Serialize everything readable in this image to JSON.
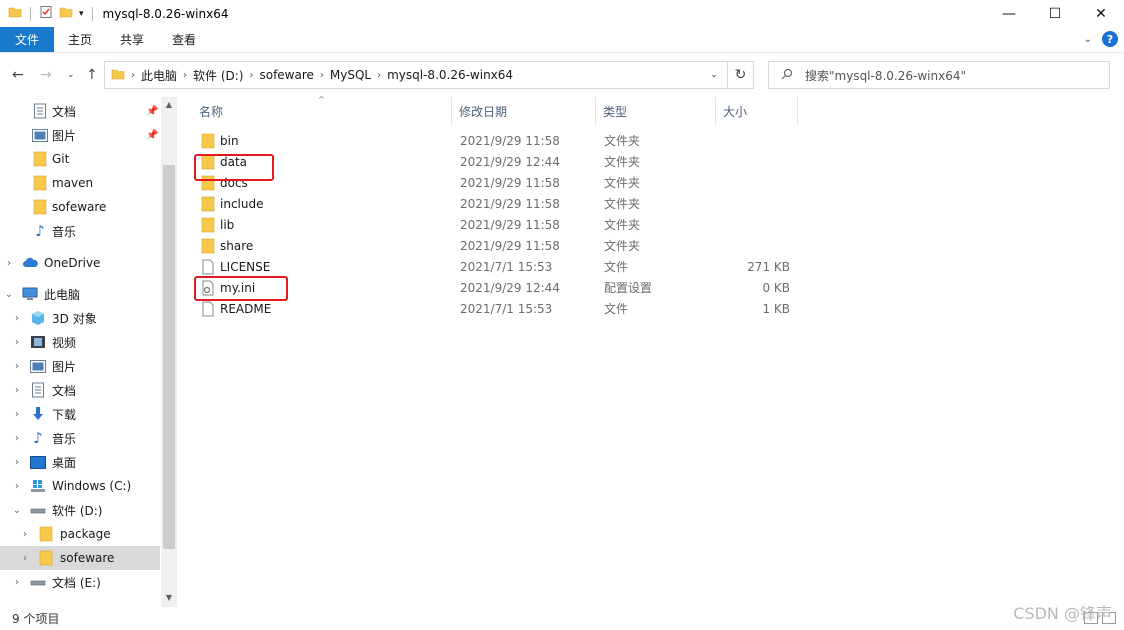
{
  "window": {
    "title": "mysql-8.0.26-winx64",
    "controls": [
      "minimize-icon",
      "maximize-icon",
      "close-icon"
    ]
  },
  "ribbon": {
    "tabs": [
      {
        "label": "文件",
        "active": true
      },
      {
        "label": "主页"
      },
      {
        "label": "共享"
      },
      {
        "label": "查看"
      }
    ],
    "accent_color": "#1979ca"
  },
  "address": {
    "crumbs": [
      "此电脑",
      "软件 (D:)",
      "sofeware",
      "MySQL",
      "mysql-8.0.26-winx64"
    ]
  },
  "search": {
    "placeholder": "搜索\"mysql-8.0.26-winx64\""
  },
  "sidebar": {
    "items": [
      {
        "label": "文档",
        "icon": "document-icon",
        "pinned": true
      },
      {
        "label": "图片",
        "icon": "picture-icon",
        "pinned": true
      },
      {
        "label": "Git",
        "icon": "folder-icon"
      },
      {
        "label": "maven",
        "icon": "folder-icon"
      },
      {
        "label": "sofeware",
        "icon": "folder-icon"
      },
      {
        "label": "音乐",
        "icon": "music-icon"
      },
      {
        "label": "OneDrive",
        "icon": "cloud-icon",
        "expander": "collapsed"
      },
      {
        "label": "此电脑",
        "icon": "computer-icon",
        "expander": "expanded"
      },
      {
        "label": "3D 对象",
        "icon": "cube-icon",
        "expander": "collapsed"
      },
      {
        "label": "视频",
        "icon": "video-icon",
        "expander": "collapsed"
      },
      {
        "label": "图片",
        "icon": "picture-icon",
        "expander": "collapsed"
      },
      {
        "label": "文档",
        "icon": "document-icon",
        "expander": "collapsed"
      },
      {
        "label": "下载",
        "icon": "download-icon",
        "expander": "collapsed"
      },
      {
        "label": "音乐",
        "icon": "music-icon",
        "expander": "collapsed"
      },
      {
        "label": "桌面",
        "icon": "desktop-icon",
        "expander": "collapsed"
      },
      {
        "label": "Windows (C:)",
        "icon": "windows-drive-icon",
        "expander": "collapsed"
      },
      {
        "label": "软件 (D:)",
        "icon": "drive-icon",
        "expander": "expanded"
      },
      {
        "label": "package",
        "icon": "folder-icon",
        "expander": "collapsed"
      },
      {
        "label": "sofeware",
        "icon": "folder-icon",
        "expander": "collapsed",
        "selected": true
      },
      {
        "label": "文档 (E:)",
        "icon": "drive-icon",
        "expander": "collapsed"
      }
    ]
  },
  "columns": {
    "name": "名称",
    "date": "修改日期",
    "type": "类型",
    "size": "大小"
  },
  "files": [
    {
      "name": "bin",
      "date": "2021/9/29 11:58",
      "type": "文件夹",
      "size": "",
      "icon": "folder-icon"
    },
    {
      "name": "data",
      "date": "2021/9/29 12:44",
      "type": "文件夹",
      "size": "",
      "icon": "folder-icon",
      "highlighted": true
    },
    {
      "name": "docs",
      "date": "2021/9/29 11:58",
      "type": "文件夹",
      "size": "",
      "icon": "folder-icon"
    },
    {
      "name": "include",
      "date": "2021/9/29 11:58",
      "type": "文件夹",
      "size": "",
      "icon": "folder-icon"
    },
    {
      "name": "lib",
      "date": "2021/9/29 11:58",
      "type": "文件夹",
      "size": "",
      "icon": "folder-icon"
    },
    {
      "name": "share",
      "date": "2021/9/29 11:58",
      "type": "文件夹",
      "size": "",
      "icon": "folder-icon"
    },
    {
      "name": "LICENSE",
      "date": "2021/7/1 15:53",
      "type": "文件",
      "size": "271 KB",
      "icon": "file-icon"
    },
    {
      "name": "my.ini",
      "date": "2021/9/29 12:44",
      "type": "配置设置",
      "size": "0 KB",
      "icon": "settings-file-icon",
      "highlighted": true
    },
    {
      "name": "README",
      "date": "2021/7/1 15:53",
      "type": "文件",
      "size": "1 KB",
      "icon": "file-icon"
    }
  ],
  "status": {
    "item_count": "9 个项目"
  },
  "watermark": "CSDN @锋声",
  "colors": {
    "folder": "#f7c94b",
    "highlight_box": "#e01b1b",
    "selected_nav": "#d9d9d9"
  }
}
